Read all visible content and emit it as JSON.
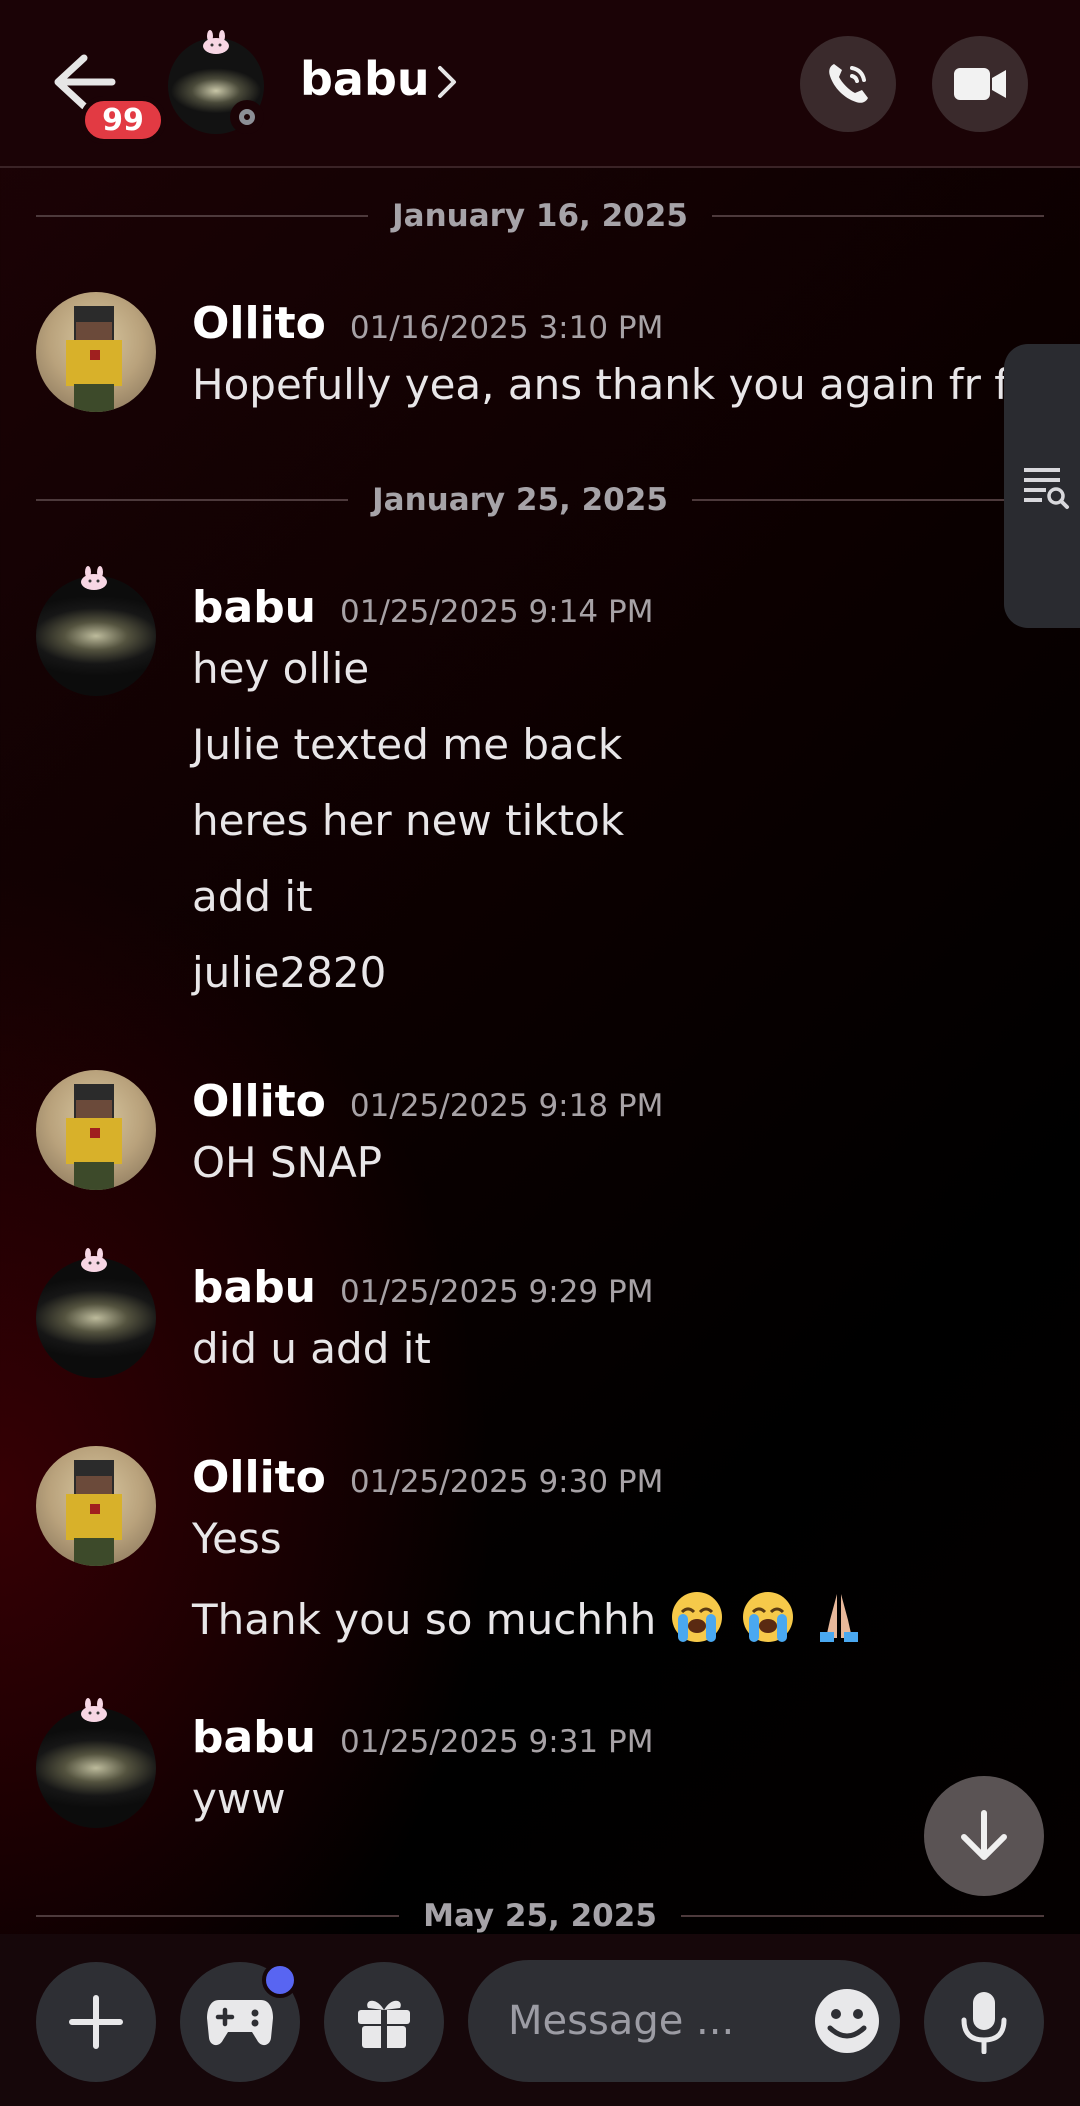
{
  "header": {
    "title": "babu",
    "unread_badge": "99"
  },
  "dates": [
    "January 16, 2025",
    "January 25, 2025",
    "May 25, 2025"
  ],
  "messages": [
    {
      "author": "Ollito",
      "time": "01/16/2025 3:10 PM",
      "lines": [
        "Hopefully yea, ans thank you again fr fr"
      ]
    },
    {
      "author": "babu",
      "time": "01/25/2025 9:14 PM",
      "lines": [
        "hey ollie",
        "Julie texted me back",
        "heres her new tiktok",
        "add it",
        "julie2820"
      ]
    },
    {
      "author": "Ollito",
      "time": "01/25/2025 9:18 PM",
      "lines": [
        "OH SNAP"
      ]
    },
    {
      "author": "babu",
      "time": "01/25/2025 9:29 PM",
      "lines": [
        "did u add it"
      ]
    },
    {
      "author": "Ollito",
      "time": "01/25/2025 9:30 PM",
      "lines": [
        "Yess",
        "Thank you so muchhh"
      ]
    },
    {
      "author": "babu",
      "time": "01/25/2025 9:31 PM",
      "lines": [
        "yww"
      ]
    }
  ],
  "composer": {
    "placeholder": "Message ..."
  },
  "icons": {
    "back": "arrow-left-icon",
    "call": "phone-icon",
    "video": "video-camera-icon",
    "search_panel": "search-list-icon",
    "scroll_down": "arrow-down-icon",
    "add": "plus-icon",
    "games": "gamepad-icon",
    "gift": "gift-icon",
    "emoji": "smiley-icon",
    "mic": "microphone-icon"
  },
  "colors": {
    "badge": "#e23a43",
    "header_bg": "#1b0306",
    "accent_dot": "#5865f2"
  }
}
